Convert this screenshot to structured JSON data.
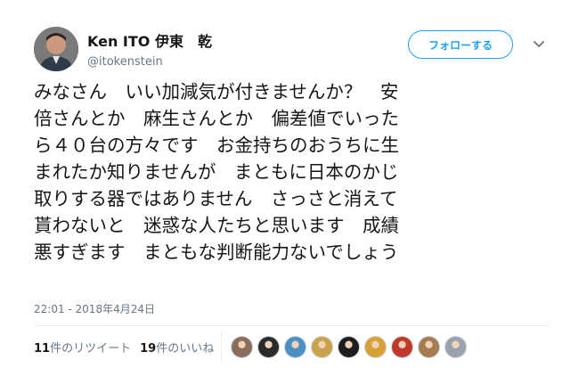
{
  "author": {
    "display_name": "Ken ITO 伊東　乾",
    "screen_name": "@itokenstein"
  },
  "follow_button": {
    "label": "フォローする"
  },
  "tweet": {
    "lines": [
      "みなさん　いい加減気が付きませんか？　安",
      "倍さんとか　麻生さんとか　偏差値でいった",
      "ら４０台の方々です　お金持ちのおうちに生",
      "まれたか知りませんが　まともに日本のかじ",
      "取りする器ではありません　さっさと消えて",
      "貰わないと　迷惑な人たちと思います　成績",
      "悪すぎます　まともな判断能力ないでしょう"
    ],
    "timestamp": "22:01 - 2018年4月24日"
  },
  "stats": {
    "retweets_count": "11",
    "retweets_label": "件のリツイート",
    "likes_count": "19",
    "likes_label": "件のいいね"
  },
  "likers": [
    {
      "icon": "liker-avatar-icon",
      "color": "#8a6d5a"
    },
    {
      "icon": "liker-avatar-icon",
      "color": "#2b2b2b"
    },
    {
      "icon": "liker-avatar-icon",
      "color": "#4a90c2"
    },
    {
      "icon": "liker-avatar-icon",
      "color": "#c9a24a"
    },
    {
      "icon": "liker-avatar-icon",
      "color": "#1e1e1e"
    },
    {
      "icon": "liker-avatar-icon",
      "color": "#d9a035"
    },
    {
      "icon": "liker-avatar-icon",
      "color": "#c0392b"
    },
    {
      "icon": "liker-avatar-icon",
      "color": "#a67c52"
    },
    {
      "icon": "liker-avatar-icon",
      "color": "#9aa3ad"
    }
  ],
  "colors": {
    "accent": "#1da1f2",
    "text_primary": "#14171a",
    "text_secondary": "#657786",
    "divider": "#e6ecf0"
  }
}
